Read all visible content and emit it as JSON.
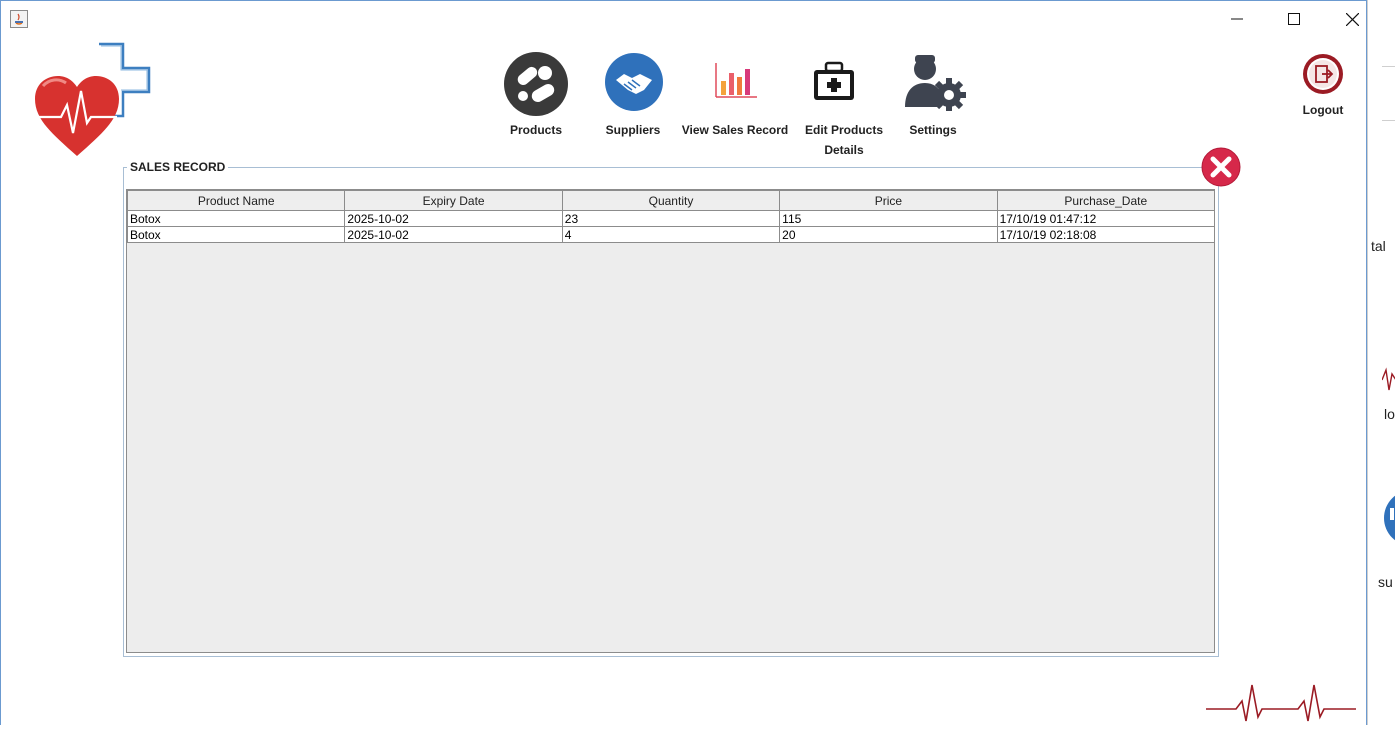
{
  "window": {
    "controls": {
      "minimize": "minimize",
      "maximize": "maximize",
      "close": "close"
    }
  },
  "nav": {
    "items": [
      {
        "label": "Products",
        "icon": "pills-icon"
      },
      {
        "label": "Suppliers",
        "icon": "handshake-icon"
      },
      {
        "label": "View Sales Record",
        "icon": "bar-chart-icon"
      },
      {
        "label_line1": "Edit Products",
        "label_line2": "Details",
        "icon": "medical-kit-icon"
      },
      {
        "label": "Settings",
        "icon": "user-gear-icon"
      }
    ]
  },
  "logout": {
    "label": "Logout"
  },
  "panel": {
    "title": "SALES RECORD"
  },
  "table": {
    "columns": [
      "Product Name",
      "Expiry Date",
      "Quantity",
      "Price",
      "Purchase_Date"
    ],
    "rows": [
      [
        "Botox",
        "2025-10-02",
        "23",
        "115",
        "17/10/19 01:47:12"
      ],
      [
        "Botox",
        "2025-10-02",
        "4",
        "20",
        "17/10/19 02:18:08"
      ]
    ]
  },
  "background": {
    "fragment1": "tal",
    "fragment2": "lo",
    "fragment3": "su"
  },
  "colors": {
    "accent_red": "#d6284a",
    "logout_red": "#9b1b24",
    "window_border": "#6b9ad0"
  }
}
